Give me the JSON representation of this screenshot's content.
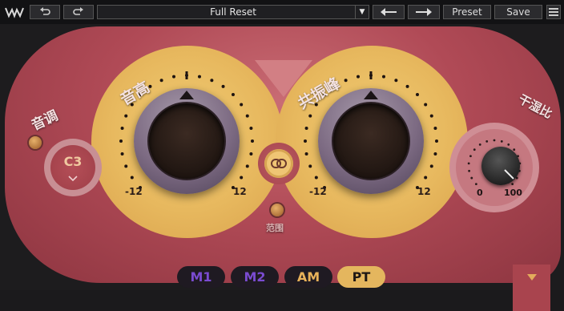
{
  "toolbar": {
    "undo_icon": "undo-icon",
    "redo_icon": "redo-icon",
    "preset_name": "Full Reset",
    "dropdown_icon": "▼",
    "prev_icon": "arrow-left-icon",
    "next_icon": "arrow-right-icon",
    "preset_label": "Preset",
    "save_label": "Save",
    "menu_icon": "menu-icon"
  },
  "plugin": {
    "pitch_label": "音调",
    "pitch_value": "C3",
    "knob1_label": "音高",
    "knob1_min": "-12",
    "knob1_max": "12",
    "knob2_label": "共振峰",
    "knob2_min": "-12",
    "knob2_max": "12",
    "range_label": "范围",
    "mix_label": "干湿比",
    "mix_min": "0",
    "mix_max": "100"
  },
  "modes": {
    "m1": "M1",
    "m2": "M2",
    "am": "AM",
    "pt": "PT",
    "active": "PT"
  },
  "colors": {
    "plate": "#b04a56",
    "ring": "#e7b85e",
    "active_mode": "#e4b65e",
    "mode_text": "#7a4bd0"
  }
}
